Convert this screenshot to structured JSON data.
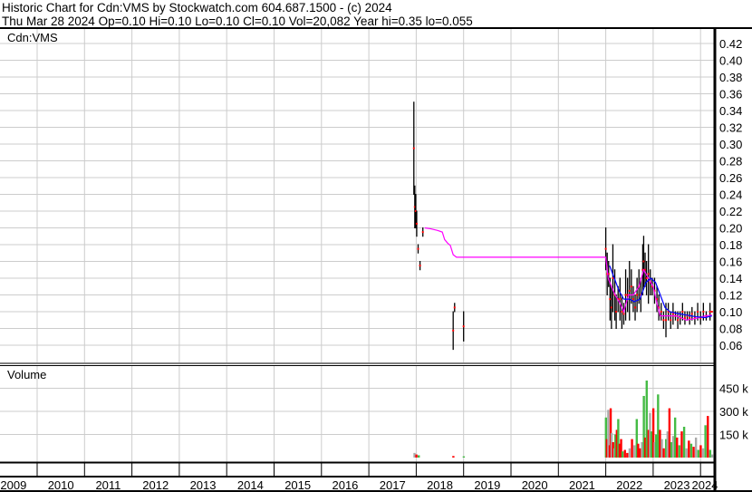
{
  "header": {
    "line1": "Historic Chart for Cdn:VMS by Stockwatch.com 604.687.1500 - (c) 2024",
    "line2": "Thu Mar 28 2024  Op=0.10  Hi=0.10  Lo=0.10  Cl=0.10  Vol=20,082  Year hi=0.35  lo=0.055"
  },
  "chart_data": {
    "type": "candlestick",
    "title": "Cdn:VMS",
    "volume_label": "Volume",
    "years": [
      "2009",
      "2010",
      "2011",
      "2012",
      "2013",
      "2014",
      "2015",
      "2016",
      "2017",
      "2018",
      "2019",
      "2020",
      "2021",
      "2022",
      "2023",
      "2024"
    ],
    "price_ticks": [
      "0.06",
      "0.08",
      "0.10",
      "0.12",
      "0.14",
      "0.16",
      "0.18",
      "0.20",
      "0.22",
      "0.24",
      "0.26",
      "0.28",
      "0.30",
      "0.32",
      "0.34",
      "0.36",
      "0.38",
      "0.40",
      "0.42"
    ],
    "price_range": [
      0.045,
      0.43
    ],
    "volume_ticks": [
      {
        "v": 150000,
        "label": "150 k"
      },
      {
        "v": 300000,
        "label": "300 k"
      },
      {
        "v": 450000,
        "label": "450 k"
      }
    ],
    "volume_range": [
      0,
      520000
    ],
    "price_bars": [
      [
        2017.95,
        0.24,
        0.35
      ],
      [
        2017.97,
        0.2,
        0.25
      ],
      [
        2017.99,
        0.2,
        0.24
      ],
      [
        2018.01,
        0.19,
        0.22
      ],
      [
        2018.04,
        0.17,
        0.18
      ],
      [
        2018.08,
        0.15,
        0.16
      ],
      [
        2018.14,
        0.19,
        0.2
      ],
      [
        2018.78,
        0.055,
        0.1
      ],
      [
        2018.81,
        0.1,
        0.11
      ],
      [
        2019.0,
        0.065,
        0.1
      ],
      [
        2022.0,
        0.15,
        0.2
      ],
      [
        2022.03,
        0.12,
        0.17
      ],
      [
        2022.06,
        0.13,
        0.16
      ],
      [
        2022.09,
        0.09,
        0.14
      ],
      [
        2022.12,
        0.08,
        0.13
      ],
      [
        2022.15,
        0.1,
        0.18
      ],
      [
        2022.19,
        0.09,
        0.15
      ],
      [
        2022.22,
        0.08,
        0.12
      ],
      [
        2022.26,
        0.1,
        0.13
      ],
      [
        2022.3,
        0.09,
        0.14
      ],
      [
        2022.34,
        0.08,
        0.12
      ],
      [
        2022.38,
        0.085,
        0.11
      ],
      [
        2022.42,
        0.09,
        0.15
      ],
      [
        2022.46,
        0.1,
        0.14
      ],
      [
        2022.5,
        0.09,
        0.16
      ],
      [
        2022.54,
        0.11,
        0.15
      ],
      [
        2022.58,
        0.1,
        0.13
      ],
      [
        2022.62,
        0.09,
        0.12
      ],
      [
        2022.66,
        0.1,
        0.14
      ],
      [
        2022.7,
        0.11,
        0.15
      ],
      [
        2022.74,
        0.1,
        0.14
      ],
      [
        2022.78,
        0.12,
        0.18
      ],
      [
        2022.8,
        0.13,
        0.19
      ],
      [
        2022.83,
        0.13,
        0.17
      ],
      [
        2022.86,
        0.12,
        0.16
      ],
      [
        2022.9,
        0.11,
        0.18
      ],
      [
        2022.94,
        0.12,
        0.15
      ],
      [
        2022.98,
        0.12,
        0.14
      ],
      [
        2023.03,
        0.11,
        0.14
      ],
      [
        2023.08,
        0.1,
        0.13
      ],
      [
        2023.12,
        0.09,
        0.12
      ],
      [
        2023.17,
        0.09,
        0.11
      ],
      [
        2023.22,
        0.08,
        0.1
      ],
      [
        2023.27,
        0.07,
        0.11
      ],
      [
        2023.32,
        0.09,
        0.11
      ],
      [
        2023.37,
        0.08,
        0.1
      ],
      [
        2023.42,
        0.085,
        0.11
      ],
      [
        2023.47,
        0.09,
        0.1
      ],
      [
        2023.52,
        0.08,
        0.1
      ],
      [
        2023.57,
        0.085,
        0.1
      ],
      [
        2023.62,
        0.09,
        0.11
      ],
      [
        2023.67,
        0.085,
        0.1
      ],
      [
        2023.72,
        0.09,
        0.1
      ],
      [
        2023.77,
        0.085,
        0.1
      ],
      [
        2023.82,
        0.09,
        0.105
      ],
      [
        2023.88,
        0.085,
        0.1
      ],
      [
        2023.94,
        0.09,
        0.11
      ],
      [
        2024.0,
        0.085,
        0.1
      ],
      [
        2024.06,
        0.09,
        0.11
      ],
      [
        2024.12,
        0.09,
        0.1
      ],
      [
        2024.2,
        0.09,
        0.11
      ],
      [
        2024.24,
        0.1,
        0.1
      ]
    ],
    "ma_short": [
      [
        2018.18,
        0.2
      ],
      [
        2018.3,
        0.199
      ],
      [
        2018.45,
        0.197
      ],
      [
        2018.55,
        0.195
      ],
      [
        2018.6,
        0.186
      ],
      [
        2018.66,
        0.182
      ],
      [
        2018.72,
        0.179
      ],
      [
        2018.78,
        0.168
      ],
      [
        2018.85,
        0.165
      ],
      [
        2022.0,
        0.165
      ],
      [
        2022.05,
        0.14
      ],
      [
        2022.12,
        0.13
      ],
      [
        2022.2,
        0.12
      ],
      [
        2022.3,
        0.11
      ],
      [
        2022.38,
        0.1
      ],
      [
        2022.48,
        0.12
      ],
      [
        2022.58,
        0.12
      ],
      [
        2022.7,
        0.13
      ],
      [
        2022.8,
        0.15
      ],
      [
        2022.9,
        0.14
      ],
      [
        2023.0,
        0.13
      ],
      [
        2023.08,
        0.11
      ],
      [
        2023.15,
        0.095
      ],
      [
        2023.3,
        0.095
      ],
      [
        2023.5,
        0.095
      ],
      [
        2023.7,
        0.09
      ],
      [
        2023.9,
        0.092
      ],
      [
        2024.1,
        0.095
      ],
      [
        2024.24,
        0.096
      ]
    ],
    "ma_long": [
      [
        2022.08,
        0.155
      ],
      [
        2022.18,
        0.14
      ],
      [
        2022.28,
        0.125
      ],
      [
        2022.38,
        0.115
      ],
      [
        2022.5,
        0.115
      ],
      [
        2022.6,
        0.112
      ],
      [
        2022.72,
        0.115
      ],
      [
        2022.85,
        0.135
      ],
      [
        2022.95,
        0.14
      ],
      [
        2023.05,
        0.135
      ],
      [
        2023.15,
        0.12
      ],
      [
        2023.25,
        0.105
      ],
      [
        2023.35,
        0.1
      ],
      [
        2023.5,
        0.098
      ],
      [
        2023.7,
        0.096
      ],
      [
        2023.9,
        0.094
      ],
      [
        2024.1,
        0.093
      ],
      [
        2024.24,
        0.095
      ]
    ],
    "volume_bars": [
      [
        2017.96,
        30000,
        "gray"
      ],
      [
        2018.0,
        20000,
        "red"
      ],
      [
        2018.05,
        15000,
        "green"
      ],
      [
        2018.78,
        10000,
        "red"
      ],
      [
        2019.0,
        8000,
        "green"
      ],
      [
        2022.0,
        260000,
        "green"
      ],
      [
        2022.02,
        120000,
        "red"
      ],
      [
        2022.05,
        310000,
        "gray"
      ],
      [
        2022.08,
        80000,
        "red"
      ],
      [
        2022.1,
        320000,
        "red"
      ],
      [
        2022.12,
        160000,
        "gray"
      ],
      [
        2022.15,
        100000,
        "red"
      ],
      [
        2022.18,
        60000,
        "gray"
      ],
      [
        2022.2,
        150000,
        "green"
      ],
      [
        2022.23,
        180000,
        "red"
      ],
      [
        2022.26,
        250000,
        "green"
      ],
      [
        2022.29,
        90000,
        "red"
      ],
      [
        2022.32,
        120000,
        "red"
      ],
      [
        2022.35,
        40000,
        "green"
      ],
      [
        2022.4,
        50000,
        "red"
      ],
      [
        2022.45,
        30000,
        "red"
      ],
      [
        2022.5,
        60000,
        "gray"
      ],
      [
        2022.55,
        120000,
        "red"
      ],
      [
        2022.6,
        80000,
        "gray"
      ],
      [
        2022.65,
        250000,
        "green"
      ],
      [
        2022.68,
        90000,
        "red"
      ],
      [
        2022.72,
        60000,
        "red"
      ],
      [
        2022.76,
        100000,
        "gray"
      ],
      [
        2022.8,
        400000,
        "green"
      ],
      [
        2022.83,
        130000,
        "red"
      ],
      [
        2022.86,
        500000,
        "green"
      ],
      [
        2022.9,
        180000,
        "red"
      ],
      [
        2022.93,
        290000,
        "gray"
      ],
      [
        2022.96,
        170000,
        "green"
      ],
      [
        2023.0,
        320000,
        "red"
      ],
      [
        2023.03,
        100000,
        "gray"
      ],
      [
        2023.06,
        150000,
        "green"
      ],
      [
        2023.1,
        410000,
        "green"
      ],
      [
        2023.14,
        180000,
        "red"
      ],
      [
        2023.18,
        120000,
        "gray"
      ],
      [
        2023.22,
        60000,
        "red"
      ],
      [
        2023.27,
        120000,
        "green"
      ],
      [
        2023.3,
        170000,
        "gray"
      ],
      [
        2023.34,
        320000,
        "red"
      ],
      [
        2023.38,
        100000,
        "green"
      ],
      [
        2023.42,
        140000,
        "gray"
      ],
      [
        2023.46,
        260000,
        "green"
      ],
      [
        2023.5,
        130000,
        "red"
      ],
      [
        2023.55,
        80000,
        "green"
      ],
      [
        2023.6,
        170000,
        "red"
      ],
      [
        2023.65,
        200000,
        "green"
      ],
      [
        2023.7,
        60000,
        "gray"
      ],
      [
        2023.75,
        110000,
        "red"
      ],
      [
        2023.8,
        90000,
        "green"
      ],
      [
        2023.85,
        70000,
        "red"
      ],
      [
        2023.9,
        130000,
        "gray"
      ],
      [
        2023.95,
        50000,
        "green"
      ],
      [
        2024.0,
        80000,
        "red"
      ],
      [
        2024.05,
        60000,
        "gray"
      ],
      [
        2024.1,
        210000,
        "green"
      ],
      [
        2024.15,
        270000,
        "red"
      ],
      [
        2024.2,
        50000,
        "green"
      ],
      [
        2024.24,
        20000,
        "gray"
      ]
    ],
    "colors": {
      "bar": "#000000",
      "dot": "#ff0000",
      "ma_short": "#ff00ff",
      "ma_long": "#0000ff",
      "vol_red": "#ff0000",
      "vol_green": "#44bb44",
      "vol_gray": "#aaaaaa",
      "grid": "#cccccc"
    }
  }
}
